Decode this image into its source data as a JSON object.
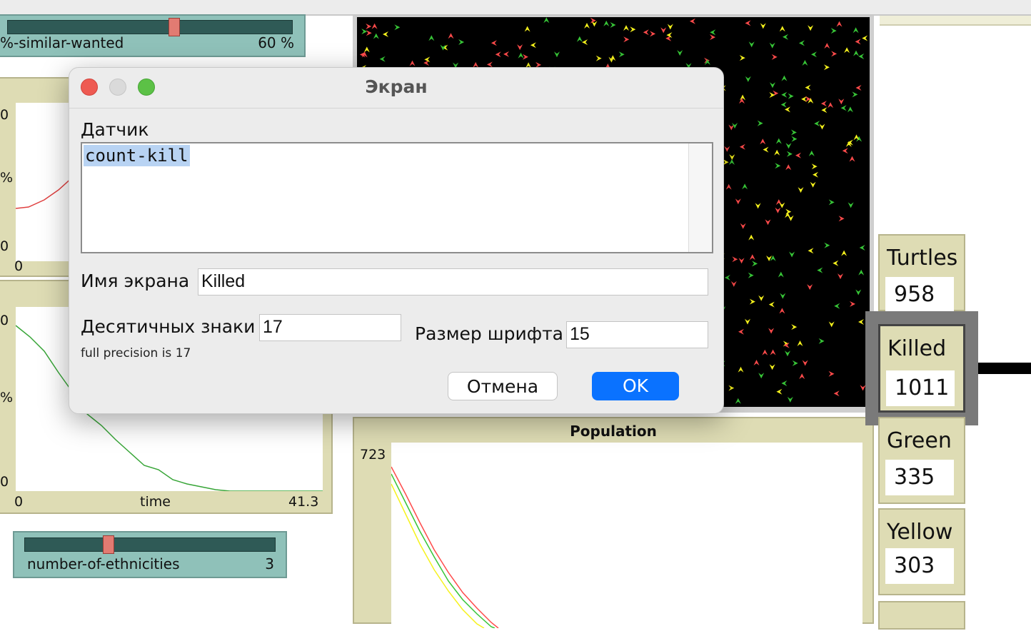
{
  "slider_similar": {
    "label": "%-similar-wanted",
    "value": "60 %"
  },
  "plot_top": {
    "y_max": "0",
    "y_mid": "%",
    "y_min": "0",
    "x_min": "0"
  },
  "plot_middle": {
    "y_max": "0",
    "y_mid": "%",
    "y_min": "0",
    "x_min": "0",
    "x_label": "time",
    "x_max": "41.3"
  },
  "slider_ethnicities": {
    "label": "number-of-ethnicities",
    "value": "3"
  },
  "population_plot": {
    "title": "Population",
    "y_max": "723"
  },
  "monitors": [
    {
      "label": "Turtles",
      "value": "958"
    },
    {
      "label": "Killed",
      "value": "1011"
    },
    {
      "label": "Green",
      "value": "335"
    },
    {
      "label": "Yellow",
      "value": "303"
    }
  ],
  "colors": {
    "red": "#ff4b4b",
    "yellow": "#f6f21d",
    "green": "#37c537",
    "accent_button": "#0a72ff"
  },
  "dialog": {
    "title": "Экран",
    "reporter_label": "Датчик",
    "reporter_code": "count-kill",
    "display_name_label": "Имя экрана",
    "display_name_value": "Killed",
    "decimal_label": "Десятичных знаки",
    "decimal_value": "17",
    "precision_note": "full precision is 17",
    "font_size_label": "Размер шрифта",
    "font_size_value": "15",
    "cancel_label": "Отмена",
    "ok_label": "OK"
  }
}
